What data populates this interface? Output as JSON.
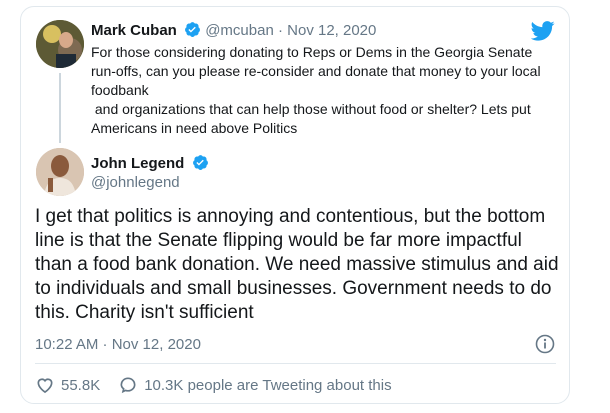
{
  "quoted_tweet": {
    "name": "Mark Cuban",
    "handle": "@mcuban",
    "separator": "·",
    "date": "Nov 12, 2020",
    "text": "For those considering donating to Reps or Dems in the Georgia Senate run-offs, can you please re-consider and donate that money to your local foodbank\n and organizations that can help those without food or shelter? Lets put Americans in need above Politics"
  },
  "tweet": {
    "name": "John Legend",
    "handle": "@johnlegend",
    "text": "I get that politics is annoying and contentious, but the bottom line is that the Senate flipping would be far more impactful than a food bank donation. We need massive stimulus and aid to individuals and small businesses. Government needs to do this. Charity isn't sufficient",
    "timestamp": "10:22 AM · Nov 12, 2020",
    "likes": "55.8K",
    "conversation": "10.3K people are Tweeting about this"
  },
  "colors": {
    "twitter_blue": "#1da1f2",
    "secondary_text": "#657786",
    "primary_text": "#14171a",
    "like_red": "#e0245e"
  },
  "icons": [
    "twitter-bird-icon",
    "verified-badge-icon",
    "info-icon",
    "heart-icon",
    "comment-icon"
  ]
}
